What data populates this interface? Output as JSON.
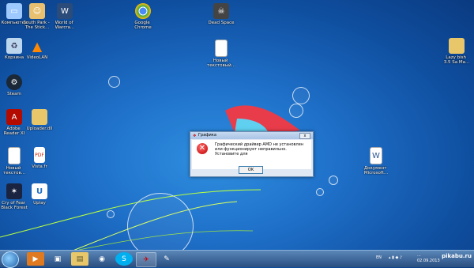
{
  "desktop": {
    "icons": [
      {
        "label": "Компьютер",
        "icon": "computer-icon",
        "color": "#9ec9ff"
      },
      {
        "label": "South Park - \nThe Stick...",
        "icon": "south-park-icon",
        "color": "#e8c070"
      },
      {
        "label": "World of \nWarcra...",
        "icon": "wow-icon",
        "color": "#2b4b7a"
      },
      {
        "label": "Google \nChrome",
        "icon": "chrome-icon",
        "color": "#ffffff"
      },
      {
        "label": "Dead Space",
        "icon": "dead-space-icon",
        "color": "#444444"
      },
      {
        "label": "Корзина",
        "icon": "recycle-bin-icon",
        "color": "#bcd6ee"
      },
      {
        "label": "VideoLAN",
        "icon": "vlc-icon",
        "color": "#ff8800"
      },
      {
        "label": "Новый \nтекстовый...",
        "icon": "text-document-icon",
        "color": "#ffffff"
      },
      {
        "label": "Lazy bish \n3.5 Sa Ma...",
        "icon": "folder-icon",
        "color": "#e8c66a"
      },
      {
        "label": "Steam",
        "icon": "steam-icon",
        "color": "#1b2838"
      },
      {
        "label": "Adobe \nReader XI",
        "icon": "adobe-reader-icon",
        "color": "#b30b00"
      },
      {
        "label": "Uploader.dll",
        "icon": "folder-icon",
        "color": "#e8c66a"
      },
      {
        "label": "Новый \nтекстов...",
        "icon": "text-document-icon",
        "color": "#ffffff"
      },
      {
        "label": "Vista.fr",
        "icon": "pdf-icon",
        "color": "#cc2200"
      },
      {
        "label": "Документ \nMicrosoft...",
        "icon": "word-document-icon",
        "color": "#ffffff"
      },
      {
        "label": "Cry of Fear \nBlack Forest",
        "icon": "cry-of-fear-icon",
        "color": "#1a2440"
      },
      {
        "label": "Uplay",
        "icon": "uplay-icon",
        "color": "#ffffff"
      }
    ]
  },
  "dialog": {
    "title": "Графика",
    "message": "Графический драйвер AMD не установлен или функционирует неправильно. Установите для",
    "ok_label": "OK",
    "close_label": "x"
  },
  "taskbar": {
    "items": [
      {
        "icon": "media-player-icon",
        "glyph": "▶",
        "active": false
      },
      {
        "icon": "windows-explorer-icon",
        "glyph": "▣",
        "active": false
      },
      {
        "icon": "folder-icon",
        "glyph": "▤",
        "active": false
      },
      {
        "icon": "chrome-icon",
        "glyph": "◉",
        "active": false
      },
      {
        "icon": "skype-icon",
        "glyph": "S",
        "active": false
      },
      {
        "icon": "app-icon",
        "glyph": "✈",
        "active": true
      },
      {
        "icon": "paint-icon",
        "glyph": "✎",
        "active": false
      }
    ],
    "language": "EN",
    "clock_time": "...",
    "clock_date": "02.09.2013"
  },
  "watermark": "pikabu.ru"
}
